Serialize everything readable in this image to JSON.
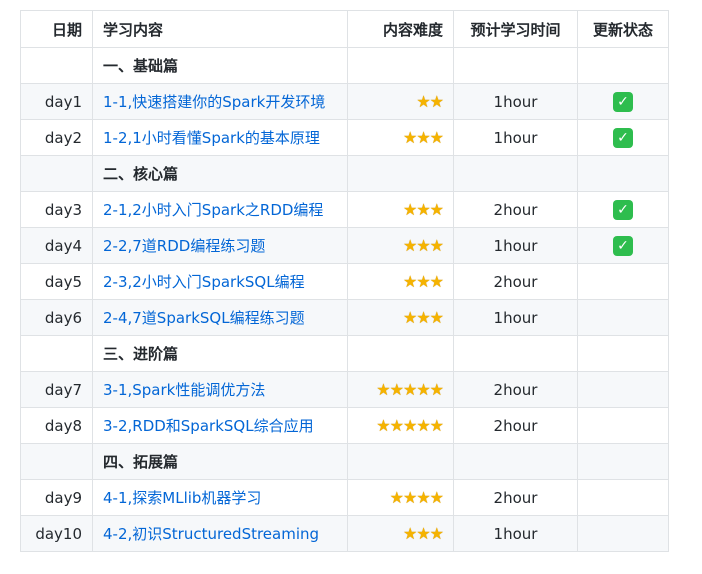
{
  "header": {
    "date": "日期",
    "content": "学习内容",
    "difficulty": "内容难度",
    "time": "预计学习时间",
    "status": "更新状态"
  },
  "rows": [
    {
      "type": "section",
      "content": "一、基础篇"
    },
    {
      "type": "item",
      "date": "day1",
      "content": "1-1,快速搭建你的Spark开发环境",
      "stars": 2,
      "time": "1hour",
      "done": true
    },
    {
      "type": "item",
      "date": "day2",
      "content": "1-2,1小时看懂Spark的基本原理",
      "stars": 3,
      "time": "1hour",
      "done": true
    },
    {
      "type": "section",
      "content": "二、核心篇"
    },
    {
      "type": "item",
      "date": "day3",
      "content": "2-1,2小时入门Spark之RDD编程",
      "stars": 3,
      "time": "2hour",
      "done": true
    },
    {
      "type": "item",
      "date": "day4",
      "content": "2-2,7道RDD编程练习题",
      "stars": 3,
      "time": "1hour",
      "done": true
    },
    {
      "type": "item",
      "date": "day5",
      "content": "2-3,2小时入门SparkSQL编程",
      "stars": 3,
      "time": "2hour",
      "done": false
    },
    {
      "type": "item",
      "date": "day6",
      "content": "2-4,7道SparkSQL编程练习题",
      "stars": 3,
      "time": "1hour",
      "done": false
    },
    {
      "type": "section",
      "content": "三、进阶篇"
    },
    {
      "type": "item",
      "date": "day7",
      "content": "3-1,Spark性能调优方法",
      "stars": 5,
      "time": "2hour",
      "done": false
    },
    {
      "type": "item",
      "date": "day8",
      "content": "3-2,RDD和SparkSQL综合应用",
      "stars": 5,
      "time": "2hour",
      "done": false
    },
    {
      "type": "section",
      "content": "四、拓展篇"
    },
    {
      "type": "item",
      "date": "day9",
      "content": "4-1,探索MLlib机器学习",
      "stars": 4,
      "time": "2hour",
      "done": false
    },
    {
      "type": "item",
      "date": "day10",
      "content": "4-2,初识StructuredStreaming",
      "stars": 3,
      "time": "1hour",
      "done": false
    }
  ],
  "icons": {
    "star": "star-icon",
    "check": "check-mark-icon"
  },
  "colors": {
    "link": "#0366d6",
    "star": "#f5b301",
    "check_bg": "#2ebd4e",
    "border": "#dfe2e5",
    "stripe": "#f6f8fa"
  }
}
